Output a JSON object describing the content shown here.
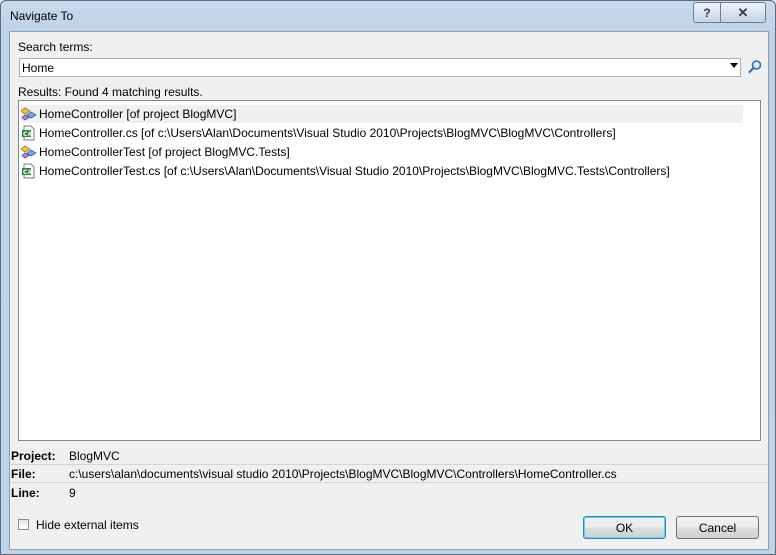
{
  "window": {
    "title": "Navigate To",
    "help_glyph": "?",
    "close_glyph": "✕"
  },
  "search": {
    "label": "Search terms:",
    "value": "Home"
  },
  "results": {
    "summary": "Results: Found 4 matching results.",
    "items": [
      {
        "text": "HomeController [of project BlogMVC]",
        "icon": "class-icon",
        "selected": true
      },
      {
        "text": "HomeController.cs [of c:\\Users\\Alan\\Documents\\Visual Studio 2010\\Projects\\BlogMVC\\BlogMVC\\Controllers]",
        "icon": "cs-file-icon",
        "selected": false
      },
      {
        "text": "HomeControllerTest [of project BlogMVC.Tests]",
        "icon": "class-icon",
        "selected": false
      },
      {
        "text": "HomeControllerTest.cs [of c:\\Users\\Alan\\Documents\\Visual Studio 2010\\Projects\\BlogMVC\\BlogMVC.Tests\\Controllers]",
        "icon": "cs-file-icon",
        "selected": false
      }
    ]
  },
  "details": {
    "project_label": "Project:",
    "project_value": "BlogMVC",
    "file_label": "File:",
    "file_value": "c:\\users\\alan\\documents\\visual studio 2010\\Projects\\BlogMVC\\BlogMVC\\Controllers\\HomeController.cs",
    "line_label": "Line:",
    "line_value": "9"
  },
  "options": {
    "hide_external_label": "Hide external items",
    "hide_external_checked": false
  },
  "buttons": {
    "ok_label": "OK",
    "cancel_label": "Cancel"
  }
}
